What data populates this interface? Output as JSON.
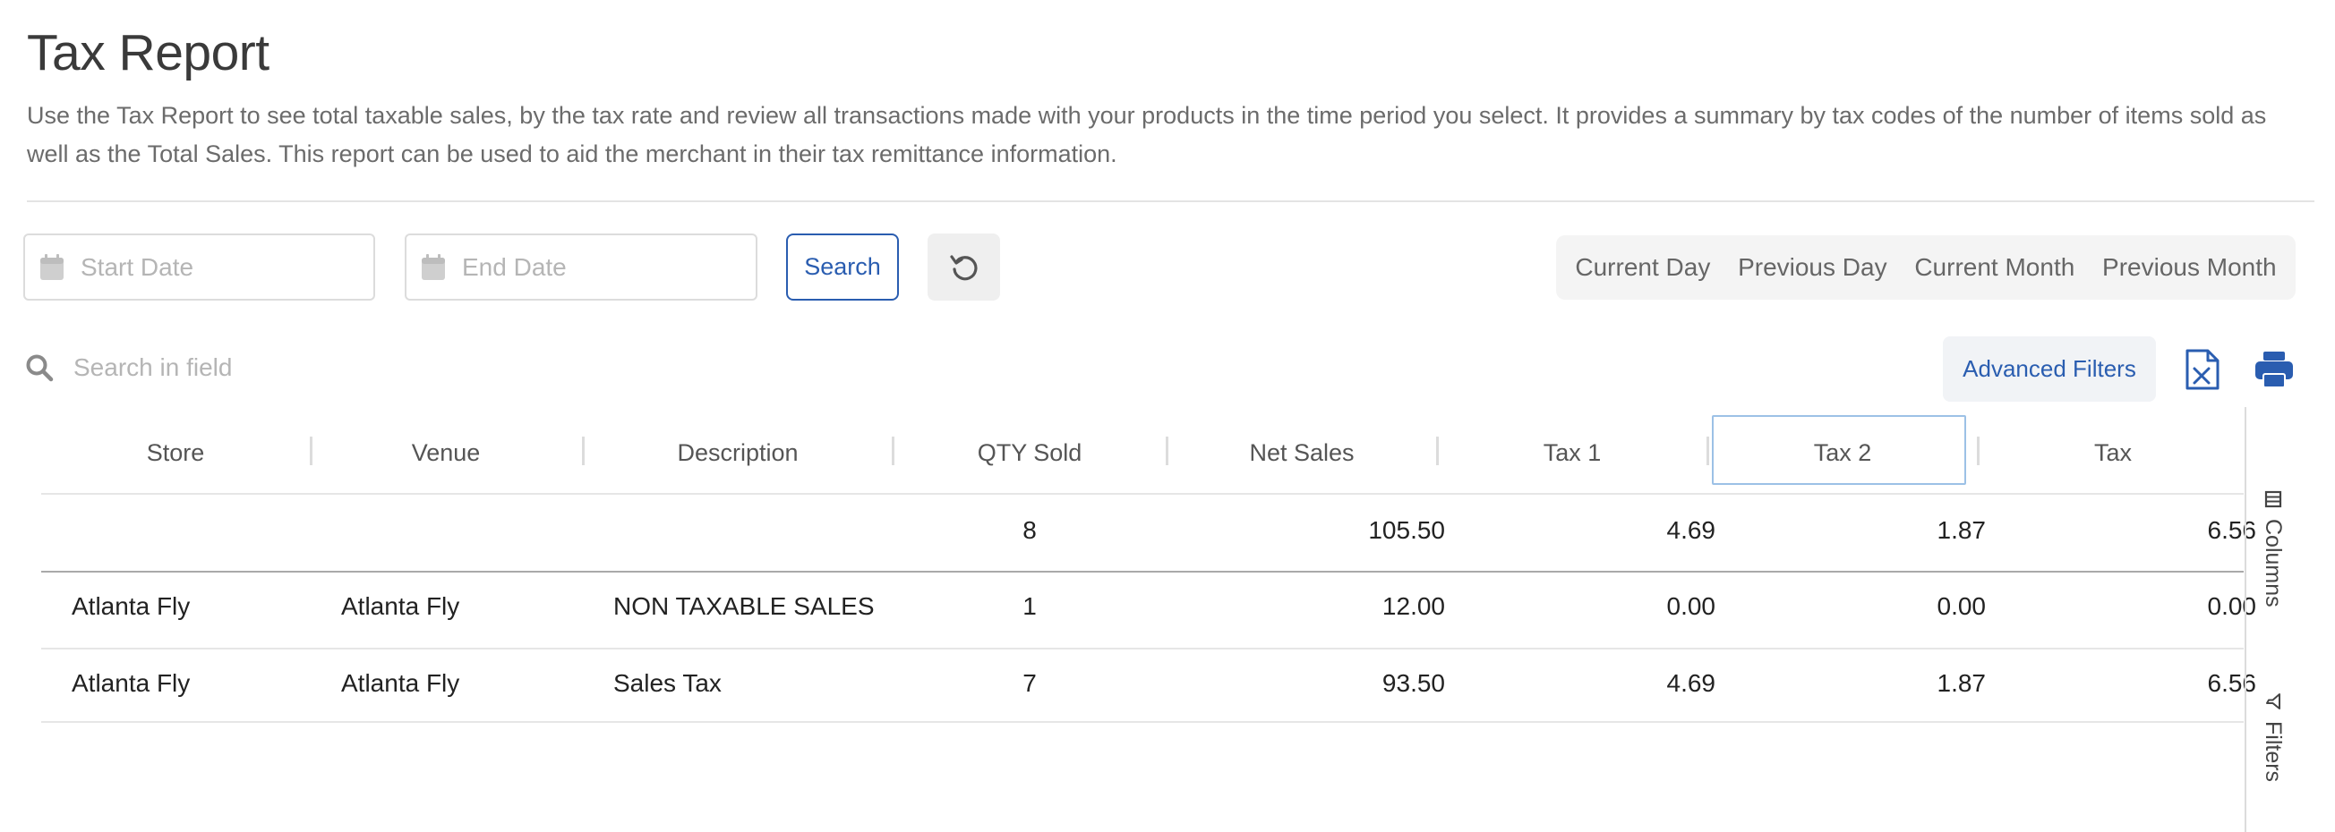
{
  "page": {
    "title": "Tax Report",
    "description": "Use the Tax Report to see total taxable sales, by the tax rate and review all transactions made with your products in the time period you select. It provides a summary by tax codes of the number of items sold as well as the Total Sales. This report can be used to aid the merchant in their tax remittance information."
  },
  "filters": {
    "start_date_placeholder": "Start Date",
    "end_date_placeholder": "End Date",
    "search_label": "Search",
    "quick_ranges": [
      "Current Day",
      "Previous Day",
      "Current Month",
      "Previous Month"
    ]
  },
  "toolbar": {
    "search_placeholder": "Search in field",
    "advanced_filters_label": "Advanced Filters"
  },
  "table": {
    "columns": [
      "Store",
      "Venue",
      "Description",
      "QTY Sold",
      "Net Sales",
      "Tax 1",
      "Tax 2",
      "Tax"
    ],
    "totals": {
      "qty": "8",
      "net_sales": "105.50",
      "tax1": "4.69",
      "tax2": "1.87",
      "tax": "6.56"
    },
    "rows": [
      {
        "store": "Atlanta Fly",
        "venue": "Atlanta Fly",
        "description": "NON TAXABLE SALES",
        "qty": "1",
        "net_sales": "12.00",
        "tax1": "0.00",
        "tax2": "0.00",
        "tax": "0.00"
      },
      {
        "store": "Atlanta Fly",
        "venue": "Atlanta Fly",
        "description": "Sales Tax",
        "qty": "7",
        "net_sales": "93.50",
        "tax1": "4.69",
        "tax2": "1.87",
        "tax": "6.56"
      }
    ]
  },
  "side_panel": {
    "columns_label": "Columns",
    "filters_label": "Filters"
  },
  "colors": {
    "accent": "#2a5db0",
    "focus_border": "#9cc1e6"
  },
  "icons": [
    "calendar-icon",
    "reset-icon",
    "search-icon",
    "excel-export-icon",
    "print-icon",
    "columns-icon",
    "filter-icon"
  ]
}
